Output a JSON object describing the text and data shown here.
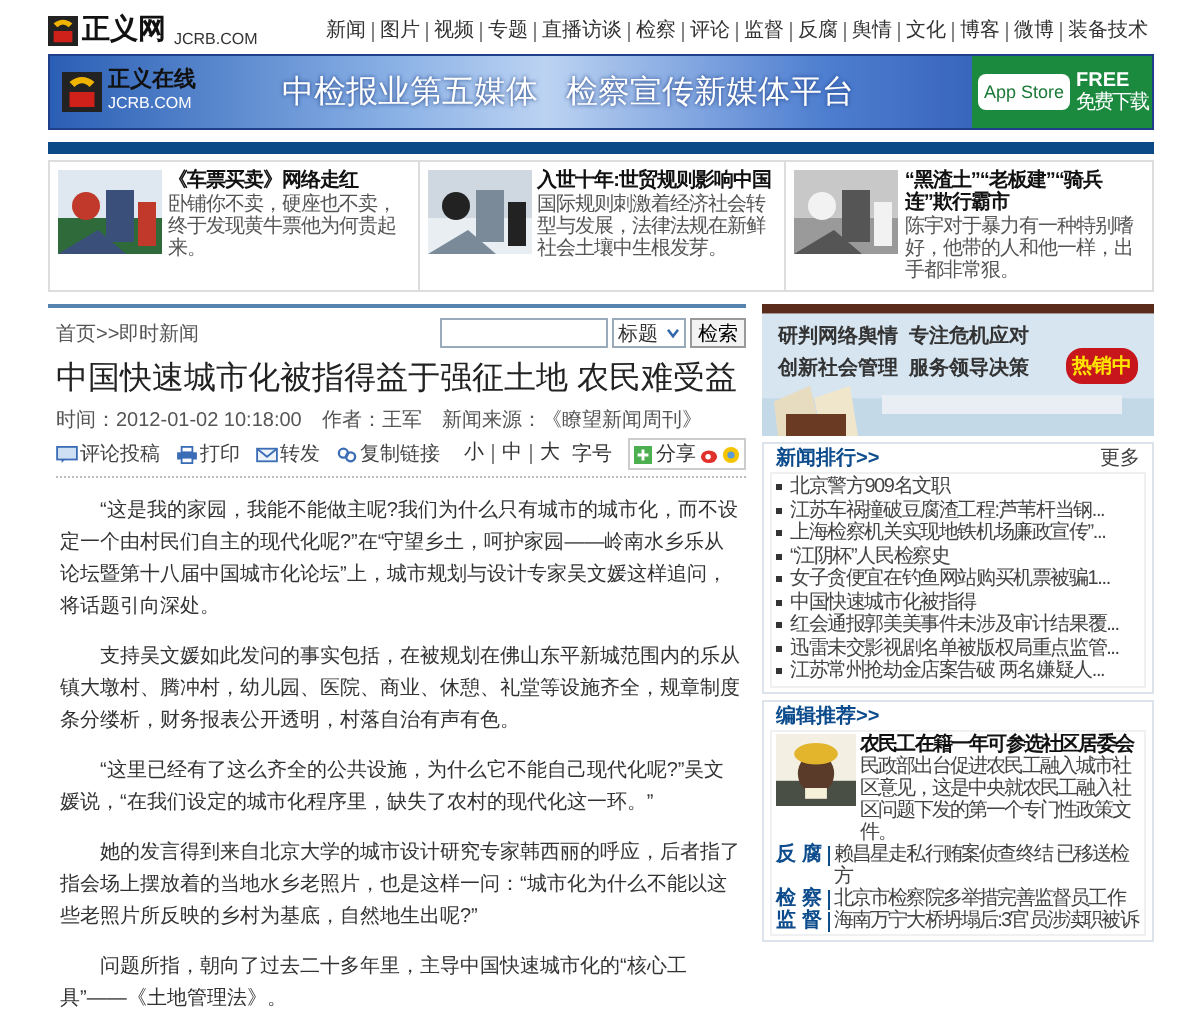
{
  "header": {
    "logo_text": "正义网",
    "logo_domain": "JCRB.COM",
    "nav": [
      "新闻",
      "图片",
      "视频",
      "专题",
      "直播访谈",
      "检察",
      "评论",
      "监督",
      "反腐",
      "舆情",
      "文化",
      "博客",
      "微博",
      "装备技术"
    ]
  },
  "banner": {
    "logo_text": "正义在线",
    "logo_domain": "JCRB.COM",
    "slogans": [
      "中检报业第五媒体",
      "检察宣传新媒体平台"
    ],
    "store_button": "App Store",
    "free": "FREE",
    "free_sub": "免费下载"
  },
  "features": [
    {
      "title": "《车票买卖》网络走红",
      "summary": "卧铺你不卖，硬座也不卖，终于发现黄牛票他为何贵起来。"
    },
    {
      "title": "入世十年:世贸规则影响中国",
      "summary": "国际规则刺激着经济社会转型与发展，法律法规在新鲜社会土壤中生根发芽。"
    },
    {
      "title": "“黑渣土”“老板建”“骑兵连”欺行霸市",
      "summary": "陈宇对于暴力有一种特别嗜好，他带的人和他一样，出手都非常狠。"
    }
  ],
  "breadcrumb": "首页>>即时新闻",
  "search": {
    "field_select": "标题",
    "button": "检索"
  },
  "article": {
    "title": "中国快速城市化被指得益于强征土地  农民难受益",
    "meta": [
      {
        "label": "时间：",
        "value": "2012-01-02 10:18:00"
      },
      {
        "label": "作者：",
        "value": "王军"
      },
      {
        "label": "新闻来源：",
        "value": "《瞭望新闻周刊》"
      }
    ],
    "tools": [
      {
        "kind": "comment",
        "label": "评论投稿"
      },
      {
        "kind": "print",
        "label": "打印"
      },
      {
        "kind": "forward",
        "label": "转发"
      },
      {
        "kind": "link",
        "label": "复制链接"
      }
    ],
    "font_sizes": [
      "小",
      "中",
      "大"
    ],
    "font_size_label": "字号",
    "share": "分享",
    "paragraphs": [
      "“这是我的家园，我能不能做主呢?我们为什么只有城市的城市化，而不设定一个由村民们自主的现代化呢?”在“守望乡土，呵护家园——岭南水乡乐从论坛暨第十八届中国城市化论坛”上，城市规划与设计专家吴文媛这样追问，将话题引向深处。",
      "支持吴文媛如此发问的事实包括，在被规划在佛山东平新城范围内的乐从镇大墩村、腾冲村，幼儿园、医院、商业、休憩、礼堂等设施齐全，规章制度条分缕析，财务报表公开透明，村落自治有声有色。",
      "“这里已经有了这么齐全的公共设施，为什么它不能自己现代化呢?”吴文媛说，“在我们设定的城市化程序里，缺失了农村的现代化这一环。”",
      "她的发言得到来自北京大学的城市设计研究专家韩西丽的呼应，后者指了指会场上摆放着的当地水乡老照片，也是这样一问：“城市化为什么不能以这些老照片所反映的乡村为基底，自然地生出呢?”",
      "问题所指，朝向了过去二十多年里，主导中国快速城市化的“核心工具”——《土地管理法》。"
    ]
  },
  "ad": {
    "lines": [
      "研判网络舆情  专注危机应对",
      "创新社会管理  服务领导决策"
    ],
    "badge": "热销中"
  },
  "ranking": {
    "title": "新闻排行>>",
    "more": "更多",
    "items": [
      "北京警方909名文职",
      "江苏车祸撞破豆腐渣工程:芦苇杆当钢...",
      "上海检察机关实现地铁机场廉政宣传”...",
      "“江阴杯”人民检察史",
      "女子贪便宜在钓鱼网站购买机票被骗1...",
      "中国快速城市化被指得",
      "红会通报郭美美事件未涉及审计结果覆...",
      "迅雷未交影视剧名单被版权局重点监管...",
      "江苏常州抢劫金店案告破 两名嫌疑人..."
    ]
  },
  "editor": {
    "title": "编辑推荐>>",
    "feature": {
      "title": "农民工在籍一年可参选社区居委会",
      "summary": "民政部出台促进农民工融入城市社区意见，这是中央就农民工融入社区问题下发的第一个专门性政策文件。"
    },
    "items": [
      {
        "category": "反 腐",
        "text": "赖昌星走私行贿案侦查终结 已移送检方"
      },
      {
        "category": "检 察",
        "text": "北京市检察院多举措完善监督员工作"
      },
      {
        "category": "监 督",
        "text": "海南万宁大桥坍塌后:3官员涉渎职被诉"
      }
    ]
  }
}
